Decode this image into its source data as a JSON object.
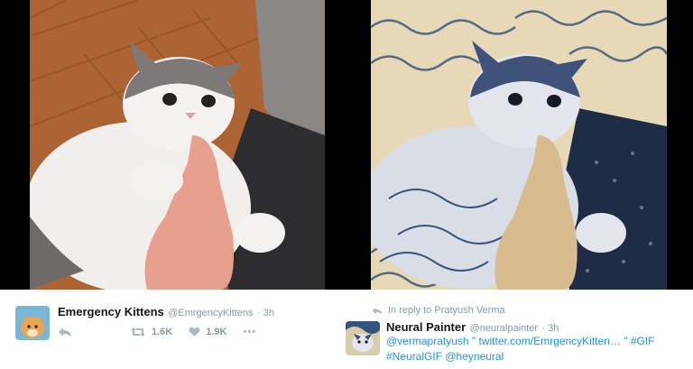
{
  "left_tweet": {
    "display_name": "Emergency Kittens",
    "handle": "@EmrgencyKittens",
    "time": "· 3h",
    "retweet_count": "1.6K",
    "like_count": "1.9K",
    "more_glyph": "•••",
    "avatar_icon": "kitten-avatar-icon"
  },
  "right_tweet": {
    "reply_context": "In reply to Pratyush Verma",
    "display_name": "Neural Painter",
    "handle": "@neuralpainter",
    "time": "· 3h",
    "line1_mention": "@vermapratyush",
    "line1_quote_open": " \" ",
    "line1_link": "twitter.com/EmrgencyKitten…",
    "line1_quote_close": " \" ",
    "line1_hashtag": "#GIF",
    "line2_hashtag": "#NeuralGIF",
    "line2_mention": "@heyneural",
    "avatar_icon": "painting-avatar-icon"
  },
  "colors": {
    "link_blue": "#1b95e0",
    "meta_gray": "#8899a6",
    "name_black": "#14171a"
  }
}
